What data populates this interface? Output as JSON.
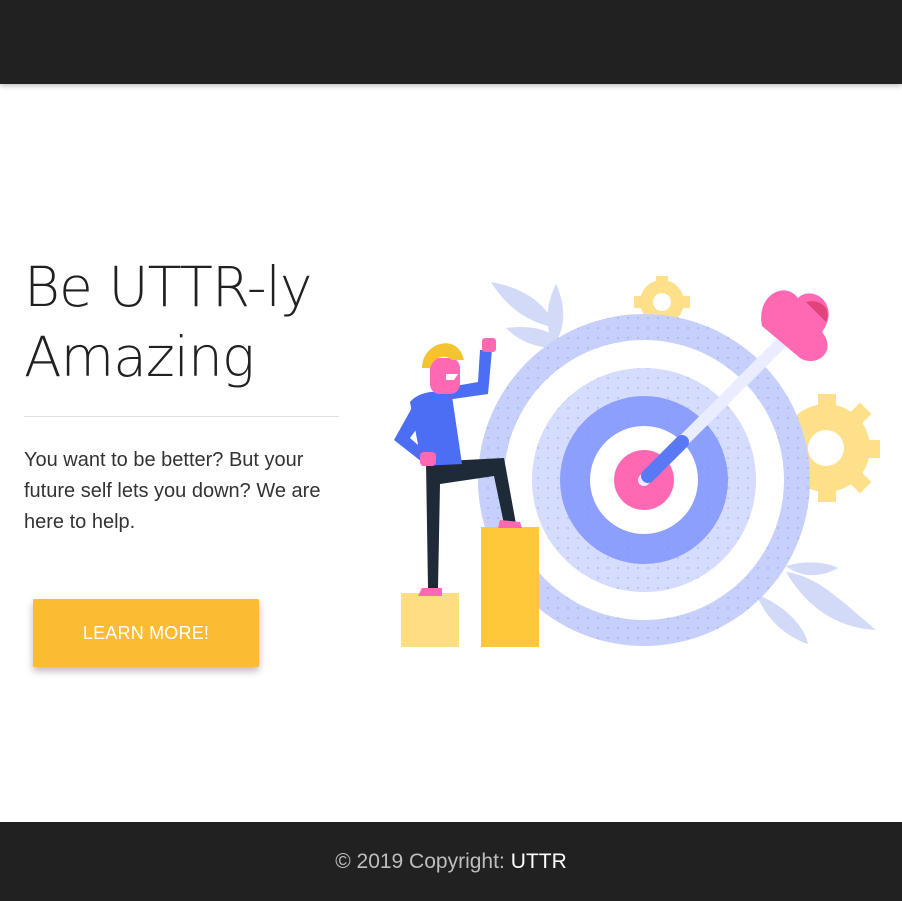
{
  "hero": {
    "title_line1": "Be UTTR-ly",
    "title_line2": "Amazing",
    "description": "You want to be better? But your future self lets you down? We are here to help.",
    "cta_label": "LEARN MORE!"
  },
  "footer": {
    "copyright": "© 2019 Copyright:",
    "brand": "UTTR"
  },
  "colors": {
    "nav_bg": "#212121",
    "cta": "#fbbc33",
    "target_blue": "#7f93ff",
    "target_pink": "#ff69b4",
    "gear_yellow": "#ffd97a"
  }
}
